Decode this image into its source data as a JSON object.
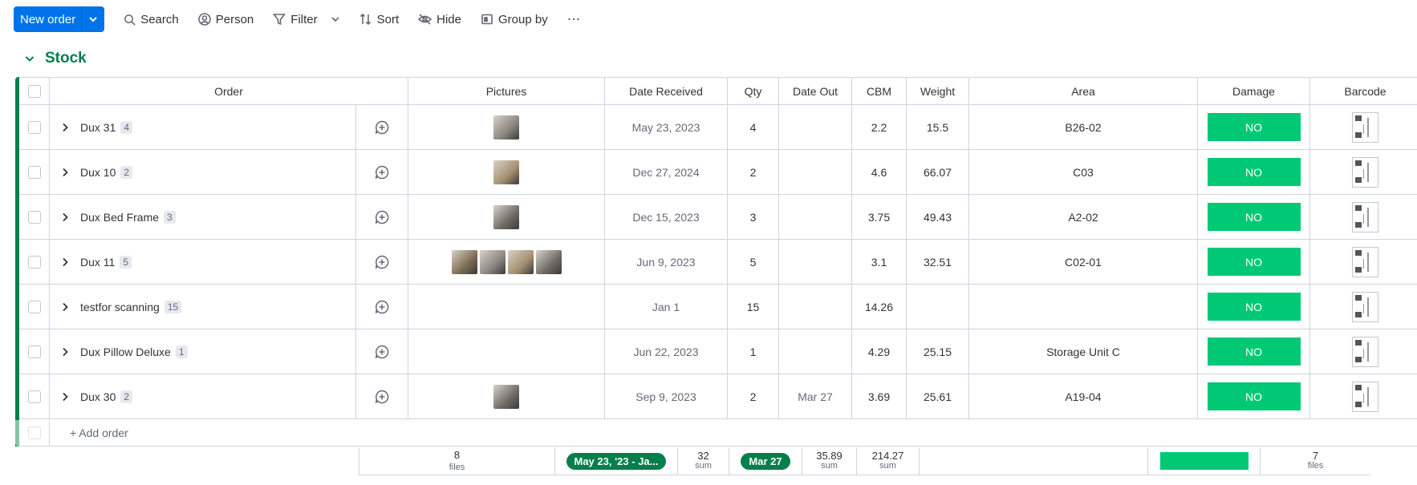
{
  "toolbar": {
    "new_label": "New order",
    "search": "Search",
    "person": "Person",
    "filter": "Filter",
    "sort": "Sort",
    "hide": "Hide",
    "group_by": "Group by"
  },
  "group": {
    "title": "Stock",
    "color": "#037f4c"
  },
  "columns": {
    "order": "Order",
    "pictures": "Pictures",
    "date_received": "Date Received",
    "qty": "Qty",
    "date_out": "Date Out",
    "cbm": "CBM",
    "weight": "Weight",
    "area": "Area",
    "damage": "Damage",
    "barcode": "Barcode"
  },
  "rows": [
    {
      "name": "Dux 31",
      "count": "4",
      "pictures": 1,
      "date_received": "May 23, 2023",
      "qty": "4",
      "date_out": "",
      "cbm": "2.2",
      "weight": "15.5",
      "area": "B26-02",
      "damage": "NO"
    },
    {
      "name": "Dux 10",
      "count": "2",
      "pictures": 1,
      "date_received": "Dec 27, 2024",
      "qty": "2",
      "date_out": "",
      "cbm": "4.6",
      "weight": "66.07",
      "area": "C03",
      "damage": "NO"
    },
    {
      "name": "Dux Bed Frame",
      "count": "3",
      "pictures": 1,
      "date_received": "Dec 15, 2023",
      "qty": "3",
      "date_out": "",
      "cbm": "3.75",
      "weight": "49.43",
      "area": "A2-02",
      "damage": "NO"
    },
    {
      "name": "Dux 11",
      "count": "5",
      "pictures": 4,
      "date_received": "Jun 9, 2023",
      "qty": "5",
      "date_out": "",
      "cbm": "3.1",
      "weight": "32.51",
      "area": "C02-01",
      "damage": "NO"
    },
    {
      "name": "testfor scanning",
      "count": "15",
      "pictures": 0,
      "date_received": "Jan 1",
      "qty": "15",
      "date_out": "",
      "cbm": "14.26",
      "weight": "",
      "area": "",
      "damage": "NO"
    },
    {
      "name": "Dux Pillow Deluxe",
      "count": "1",
      "pictures": 0,
      "date_received": "Jun 22, 2023",
      "qty": "1",
      "date_out": "",
      "cbm": "4.29",
      "weight": "25.15",
      "area": "Storage Unit C",
      "damage": "NO"
    },
    {
      "name": "Dux 30",
      "count": "2",
      "pictures": 1,
      "date_received": "Sep 9, 2023",
      "qty": "2",
      "date_out": "Mar 27",
      "cbm": "3.69",
      "weight": "25.61",
      "area": "A19-04",
      "damage": "NO"
    }
  ],
  "add_row": "+ Add order",
  "summary": {
    "pictures_value": "8",
    "pictures_unit": "files",
    "date_range": "May 23, '23 - Ja...",
    "qty_value": "32",
    "qty_unit": "sum",
    "date_out": "Mar 27",
    "cbm_value": "35.89",
    "cbm_unit": "sum",
    "weight_value": "214.27",
    "weight_unit": "sum",
    "barcode_value": "7",
    "barcode_unit": "files"
  },
  "colors": {
    "primary": "#0073ea",
    "done_green": "#00c875",
    "group_green": "#037f4c"
  }
}
